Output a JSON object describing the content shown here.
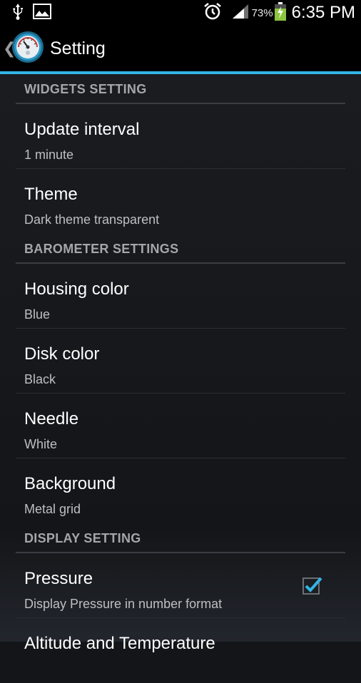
{
  "status_bar": {
    "battery_percent": "73%",
    "time": "6:35 PM",
    "icons": [
      "usb-icon",
      "image-icon",
      "alarm-icon",
      "signal-icon",
      "battery-charging-icon"
    ]
  },
  "action_bar": {
    "title": "Setting",
    "up_glyph": "❮",
    "app_icon": "barometer-icon"
  },
  "sections": [
    {
      "header": "WIDGETS SETTING",
      "items": [
        {
          "title": "Update interval",
          "summary": "1 minute"
        },
        {
          "title": "Theme",
          "summary": "Dark theme transparent"
        }
      ]
    },
    {
      "header": "BAROMETER SETTINGS",
      "items": [
        {
          "title": "Housing color",
          "summary": "Blue"
        },
        {
          "title": "Disk color",
          "summary": "Black"
        },
        {
          "title": "Needle",
          "summary": "White"
        },
        {
          "title": "Background",
          "summary": "Metal grid"
        }
      ]
    },
    {
      "header": "DISPLAY SETTING",
      "items": [
        {
          "title": "Pressure",
          "summary": "Display Pressure in number format",
          "checked": true
        },
        {
          "title": "Altitude and Temperature",
          "summary": ""
        }
      ]
    }
  ],
  "colors": {
    "accent": "#33b5e5",
    "header_text": "#a3a6aa",
    "summary_text": "#bdbfc2"
  }
}
